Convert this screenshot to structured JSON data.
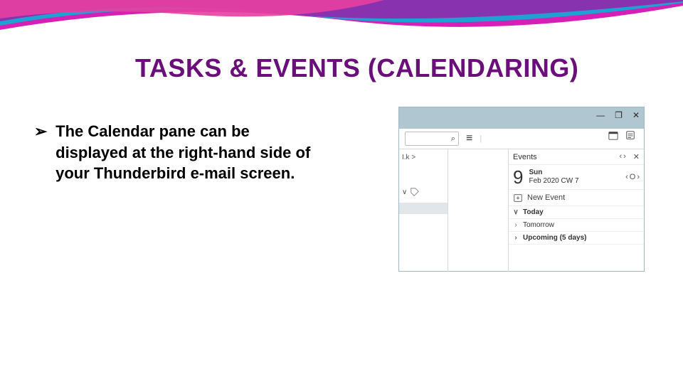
{
  "title": "TASKS & EVENTS (CALENDARING)",
  "bullet": {
    "marker": "➢",
    "text": "The Calendar pane can be displayed at the right-hand side of your Thunderbird e-mail screen."
  },
  "shot": {
    "window": {
      "min": "—",
      "restore": "❐",
      "close": "✕"
    },
    "search_glyph": "⌕",
    "menu_glyph": "≡",
    "toolbar_sep": "|",
    "left_crumb": "I.k >",
    "left_caret": "∨",
    "events": {
      "label": "Events",
      "prev": "‹",
      "next": "›",
      "close": "✕"
    },
    "day": {
      "num": "9",
      "dow": "Sun",
      "sub": "Feb 2020  CW 7",
      "prev": "‹",
      "dot": "O",
      "next": "›"
    },
    "newevent": "New Event",
    "sections": {
      "today": {
        "caret": "∨",
        "label": "Today"
      },
      "tomorrow": {
        "caret": "›",
        "label": "Tomorrow"
      },
      "upcoming": {
        "caret": "›",
        "label": "Upcoming (5 days)"
      }
    }
  }
}
